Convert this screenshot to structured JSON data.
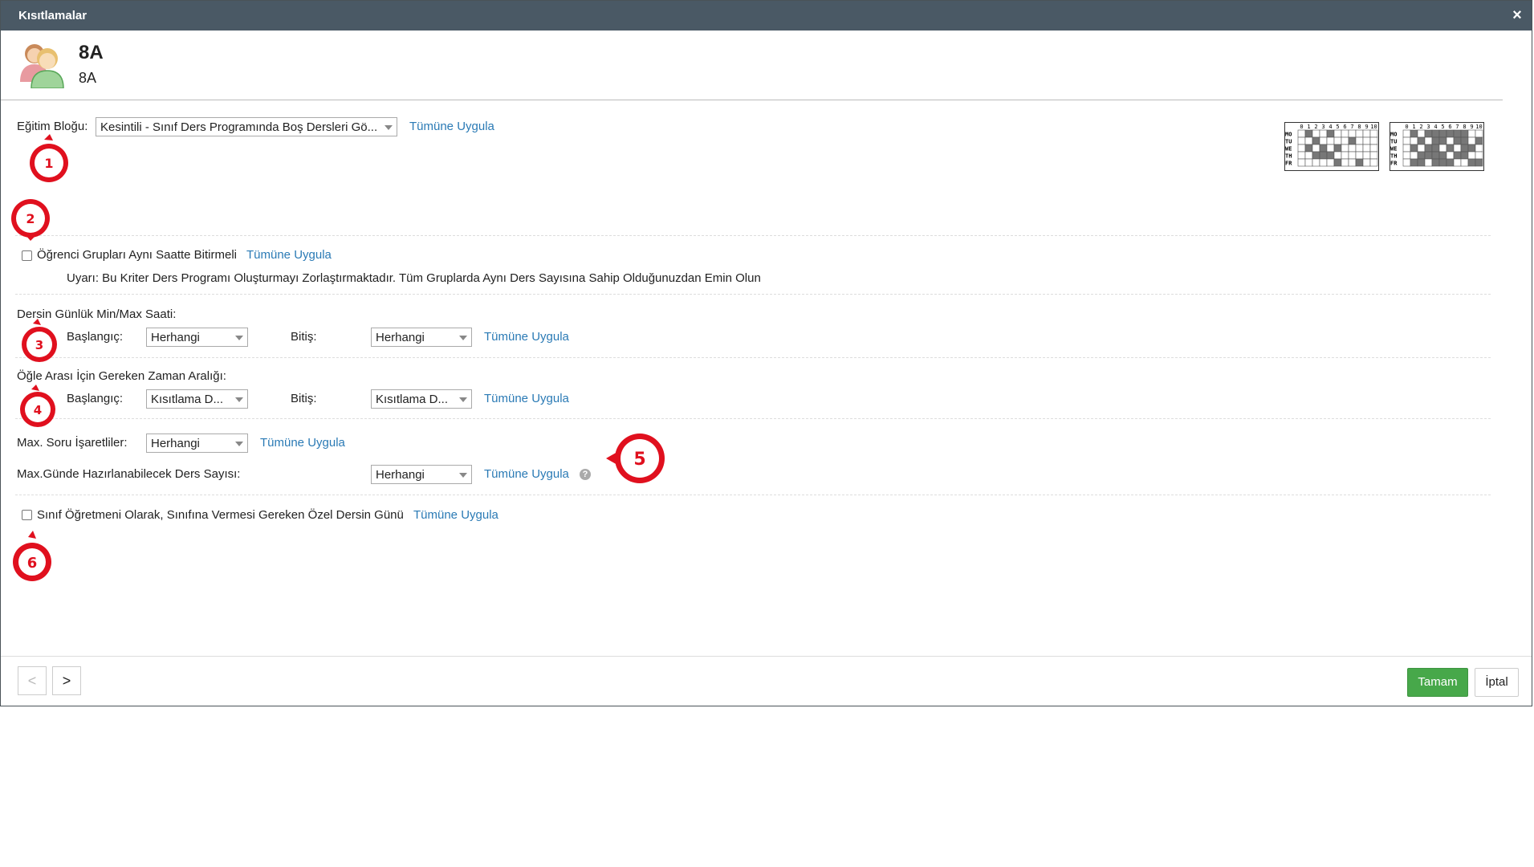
{
  "window": {
    "title": "Kısıtlamalar",
    "close_label": "×"
  },
  "header": {
    "title": "8A",
    "subtitle": "8A"
  },
  "apply_all": "Tümüne Uygula",
  "egitim": {
    "label": "Eğitim Bloğu:",
    "value": "Kesintili - Sınıf Ders Programında Boş Dersleri Gö..."
  },
  "ogrenci": {
    "label": "Öğrenci Grupları Aynı Saatte Bitirmeli",
    "warning": "Uyarı: Bu Kriter Ders Programı Oluşturmayı Zorlaştırmaktadır. Tüm Gruplarda Aynı Ders Sayısına Sahip Olduğunuzdan Emin Olun"
  },
  "dersin": {
    "label": "Dersin Günlük Min/Max Saati:",
    "start_label": "Başlangıç:",
    "start_value": "Herhangi",
    "end_label": "Bitiş:",
    "end_value": "Herhangi"
  },
  "ogle": {
    "label": "Öğle Arası İçin Gereken Zaman Aralığı:",
    "start_label": "Başlangıç:",
    "start_value": "Kısıtlama D...",
    "end_label": "Bitiş:",
    "end_value": "Kısıtlama D..."
  },
  "soru": {
    "label": "Max. Soru İşaretliler:",
    "value": "Herhangi"
  },
  "gunde": {
    "label": "Max.Günde Hazırlanabilecek Ders Sayısı:",
    "value": "Herhangi",
    "help": "?"
  },
  "sinif": {
    "label": "Sınıf Öğretmeni Olarak, Sınıfına Vermesi Gereken Özel Dersin Günü"
  },
  "markers": [
    "1",
    "2",
    "3",
    "4",
    "5",
    "6"
  ],
  "grid": {
    "columns": [
      "0",
      "1",
      "2",
      "3",
      "4",
      "5",
      "6",
      "7",
      "8",
      "9",
      "10"
    ],
    "days": [
      "MO",
      "TU",
      "WE",
      "TH",
      "FR"
    ]
  },
  "footer": {
    "prev": "<",
    "next": ">",
    "ok": "Tamam",
    "cancel": "İptal"
  },
  "colors": {
    "titlebar": "#4a5965",
    "link": "#2a7ab5",
    "ok": "#47a84a",
    "marker": "#e0101e"
  }
}
